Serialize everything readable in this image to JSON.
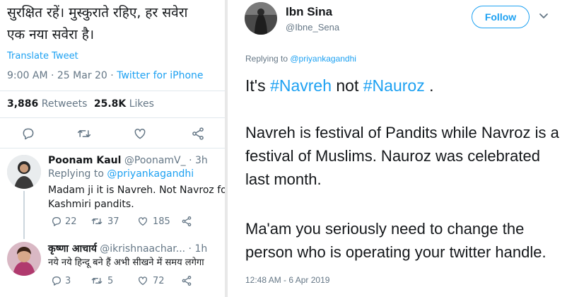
{
  "left_tweet": {
    "text_line1": "सुरक्षित रहें। मुस्कुराते रहिए, हर सवेरा",
    "text_line2": "एक नया सवेरा है।",
    "translate": "Translate Tweet",
    "time_date": "9:00 AM · 25 Mar 20 · ",
    "source": "Twitter for iPhone",
    "retweets_count": "3,886",
    "retweets_label": "Retweets",
    "likes_count": "25.8K",
    "likes_label": "Likes"
  },
  "replies": [
    {
      "name": "Poonam Kaul",
      "handle_time": "@PoonamV_ · 3h",
      "replying_to_prefix": "Replying to ",
      "replying_to_handle": "@priyankagandhi",
      "text_line1": "Madam ji it is Navreh. Not Navroz for",
      "text_line2": "Kashmiri pandits.",
      "reply_count": "22",
      "retweet_count": "37",
      "like_count": "185"
    },
    {
      "name": "कृष्णा आचार्य",
      "handle_time": "@ikrishnaachar... · 1h",
      "text_line1": "नये नये हिन्दू बने हैं अभी सीखने में समय लगेगा",
      "reply_count": "3",
      "retweet_count": "5",
      "like_count": "72"
    }
  ],
  "right_tweet": {
    "name": "Ibn Sina",
    "handle": "@Ibne_Sena",
    "follow_label": "Follow",
    "replying_to_prefix": "Replying to ",
    "replying_to_handle": "@priyankagandhi",
    "line1_a": "It's ",
    "line1_tag1": "#Navreh",
    "line1_b": " not ",
    "line1_tag2": "#Nauroz",
    "line1_c": " .",
    "para2_line1": "Navreh is festival of Pandits while Navroz is a",
    "para2_line2": "festival of Muslims. Nauroz was celebrated",
    "para2_line3": "last month.",
    "para3_line1": "Ma'am you seriously need to change the",
    "para3_line2": "person who is operating your twitter handle.",
    "timestamp": "12:48 AM - 6 Apr 2019"
  },
  "colors": {
    "accent": "#1da1f2",
    "secondary_text": "#657786",
    "divider": "#e1e8ed"
  },
  "icons": [
    "reply-icon",
    "retweet-icon",
    "like-icon",
    "share-icon",
    "chevron-down-icon"
  ]
}
